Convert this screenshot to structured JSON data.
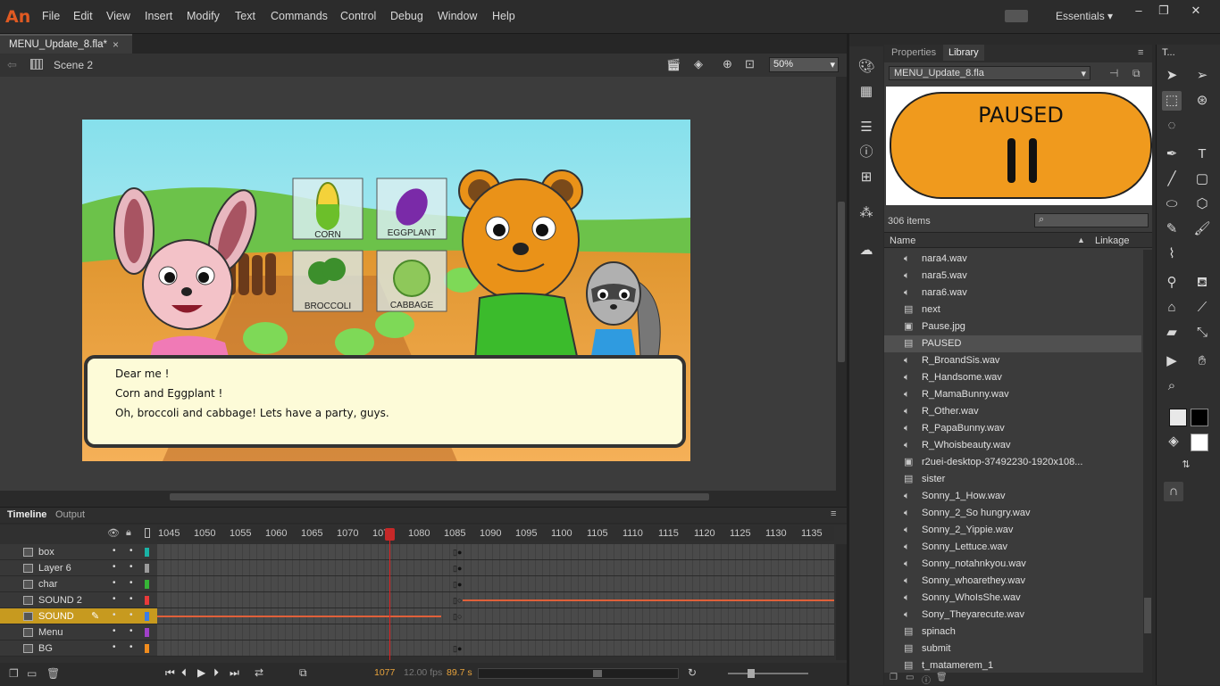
{
  "app": {
    "logo": "An",
    "workspace": "Essentials ▾"
  },
  "menu": [
    "File",
    "Edit",
    "View",
    "Insert",
    "Modify",
    "Text",
    "Commands",
    "Control",
    "Debug",
    "Window",
    "Help"
  ],
  "document": {
    "tab_label": "MENU_Update_8.fla*",
    "close": "×",
    "scene": "Scene 2",
    "zoom": "50%"
  },
  "stage": {
    "dialog_lines": [
      "Dear me !",
      "Corn and Eggplant !",
      "Oh, broccoli and cabbage! Lets have a party, guys."
    ],
    "cards": [
      "CORN",
      "EGGPLANT",
      "BROCCOLI",
      "CABBAGE"
    ]
  },
  "timeline": {
    "tabs": [
      "Timeline",
      "Output"
    ],
    "ruler": [
      "1045",
      "1050",
      "1055",
      "1060",
      "1065",
      "1070",
      "1075",
      "1080",
      "1085",
      "1090",
      "1095",
      "1100",
      "1105",
      "1110",
      "1115",
      "1120",
      "1125",
      "1130",
      "1135"
    ],
    "layers": [
      {
        "name": "box",
        "color": "#1ab3a6"
      },
      {
        "name": "Layer 6",
        "color": "#9b9b9b"
      },
      {
        "name": "char",
        "color": "#36b536"
      },
      {
        "name": "SOUND 2",
        "color": "#e83a3a"
      },
      {
        "name": "SOUND",
        "color": "#3a7de8"
      },
      {
        "name": "Menu",
        "color": "#a040c8"
      },
      {
        "name": "BG",
        "color": "#f08c1e"
      }
    ],
    "current_frame": "1077",
    "fps": "12.00 fps",
    "time": "89.7 s"
  },
  "library": {
    "tabs": [
      "Properties",
      "Library"
    ],
    "document": "MENU_Update_8.fla",
    "preview_text": "PAUSED",
    "item_count": "306 items",
    "columns": {
      "name": "Name",
      "linkage": "Linkage"
    },
    "items": [
      {
        "name": "nara4.wav",
        "icon": "sound-icon"
      },
      {
        "name": "nara5.wav",
        "icon": "sound-icon"
      },
      {
        "name": "nara6.wav",
        "icon": "sound-icon"
      },
      {
        "name": "next",
        "icon": "button-symbol-icon"
      },
      {
        "name": "Pause.jpg",
        "icon": "bitmap-icon"
      },
      {
        "name": "PAUSED",
        "icon": "button-symbol-icon"
      },
      {
        "name": "R_BroandSis.wav",
        "icon": "sound-icon"
      },
      {
        "name": "R_Handsome.wav",
        "icon": "sound-icon"
      },
      {
        "name": "R_MamaBunny.wav",
        "icon": "sound-icon"
      },
      {
        "name": "R_Other.wav",
        "icon": "sound-icon"
      },
      {
        "name": "R_PapaBunny.wav",
        "icon": "sound-icon"
      },
      {
        "name": "R_Whoisbeauty.wav",
        "icon": "sound-icon"
      },
      {
        "name": "r2uei-desktop-37492230-1920x108...",
        "icon": "bitmap-icon"
      },
      {
        "name": "sister",
        "icon": "button-symbol-icon"
      },
      {
        "name": "Sonny_1_How.wav",
        "icon": "sound-icon"
      },
      {
        "name": "Sonny_2_So hungry.wav",
        "icon": "sound-icon"
      },
      {
        "name": "Sonny_2_Yippie.wav",
        "icon": "sound-icon"
      },
      {
        "name": "Sonny_Lettuce.wav",
        "icon": "sound-icon"
      },
      {
        "name": "Sonny_notahnkyou.wav",
        "icon": "sound-icon"
      },
      {
        "name": "Sonny_whoarethey.wav",
        "icon": "sound-icon"
      },
      {
        "name": "Sonny_WhoIsShe.wav",
        "icon": "sound-icon"
      },
      {
        "name": "Sony_Theyarecute.wav",
        "icon": "sound-icon"
      },
      {
        "name": "spinach",
        "icon": "button-symbol-icon"
      },
      {
        "name": "submit",
        "icon": "button-symbol-icon"
      },
      {
        "name": "t_matamerem_1",
        "icon": "button-symbol-icon"
      }
    ]
  },
  "tools": {
    "panel_title": "T..."
  }
}
